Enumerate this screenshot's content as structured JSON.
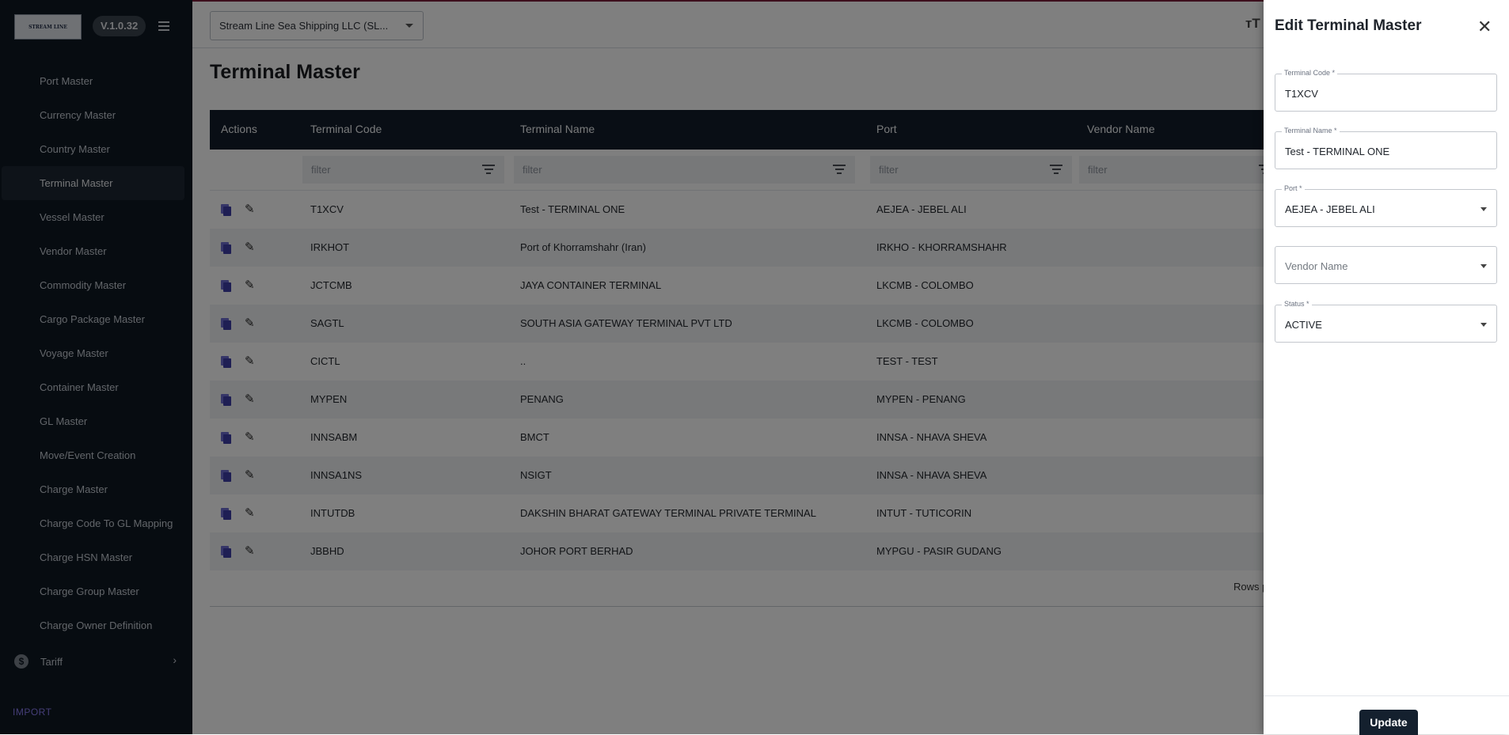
{
  "sidebar": {
    "logo_text": "STREAM LINE",
    "version": "V.1.0.32",
    "items": [
      {
        "label": "Port Master"
      },
      {
        "label": "Currency Master"
      },
      {
        "label": "Country Master"
      },
      {
        "label": "Terminal Master"
      },
      {
        "label": "Vessel Master"
      },
      {
        "label": "Vendor Master"
      },
      {
        "label": "Commodity Master"
      },
      {
        "label": "Cargo Package Master"
      },
      {
        "label": "Voyage Master"
      },
      {
        "label": "Container Master"
      },
      {
        "label": "GL Master"
      },
      {
        "label": "Move/Event Creation"
      },
      {
        "label": "Charge Master"
      },
      {
        "label": "Charge Code To GL Mapping"
      },
      {
        "label": "Charge HSN Master"
      },
      {
        "label": "Charge Group Master"
      },
      {
        "label": "Charge Owner Definition"
      }
    ],
    "active_item": "Terminal Master",
    "tariff_label": "Tariff",
    "section_label": "IMPORT"
  },
  "topbar": {
    "company": "Stream Line Sea Shipping LLC  (SL..."
  },
  "page": {
    "title": "Terminal Master"
  },
  "grid": {
    "columns": {
      "actions": "Actions",
      "terminal_code": "Terminal Code",
      "terminal_name": "Terminal Name",
      "port": "Port",
      "vendor_name": "Vendor Name"
    },
    "filter_placeholder": "filter",
    "rows": [
      {
        "code": "T1XCV",
        "name": "Test - TERMINAL ONE",
        "port": "AEJEA - JEBEL ALI"
      },
      {
        "code": "IRKHOT",
        "name": "Port of Khorramshahr (Iran)",
        "port": "IRKHO - KHORRAMSHAHR"
      },
      {
        "code": "JCTCMB",
        "name": "JAYA CONTAINER TERMINAL",
        "port": "LKCMB - COLOMBO"
      },
      {
        "code": "SAGTL",
        "name": "SOUTH ASIA GATEWAY TERMINAL PVT LTD",
        "port": "LKCMB - COLOMBO"
      },
      {
        "code": "CICTL",
        "name": "..",
        "port": "TEST - TEST"
      },
      {
        "code": "MYPEN",
        "name": "PENANG",
        "port": "MYPEN - PENANG"
      },
      {
        "code": "INNSABM",
        "name": "BMCT",
        "port": "INNSA - NHAVA SHEVA"
      },
      {
        "code": "INNSA1NS",
        "name": "NSIGT",
        "port": "INNSA - NHAVA SHEVA"
      },
      {
        "code": "INTUTDB",
        "name": "DAKSHIN BHARAT GATEWAY TERMINAL PRIVATE TERMINAL",
        "port": "INTUT - TUTICORIN"
      },
      {
        "code": "JBBHD",
        "name": "JOHOR PORT BERHAD",
        "port": "MYPGU - PASIR GUDANG"
      }
    ],
    "rows_per_page_label": "Rows p"
  },
  "drawer": {
    "title": "Edit Terminal Master",
    "fields": {
      "terminal_code": {
        "label": "Terminal Code *",
        "value": "T1XCV"
      },
      "terminal_name": {
        "label": "Terminal Name *",
        "value": "Test - TERMINAL ONE"
      },
      "port": {
        "label": "Port *",
        "value": "AEJEA - JEBEL ALI"
      },
      "vendor_name": {
        "placeholder": "Vendor Name"
      },
      "status": {
        "label": "Status *",
        "value": "ACTIVE"
      }
    },
    "update_label": "Update"
  },
  "colors": {
    "sidebar_bg": "#0e1823",
    "grid_header_bg": "#121d2a",
    "icon_accent": "#3f3fa8",
    "update_button_bg": "#14202e"
  }
}
